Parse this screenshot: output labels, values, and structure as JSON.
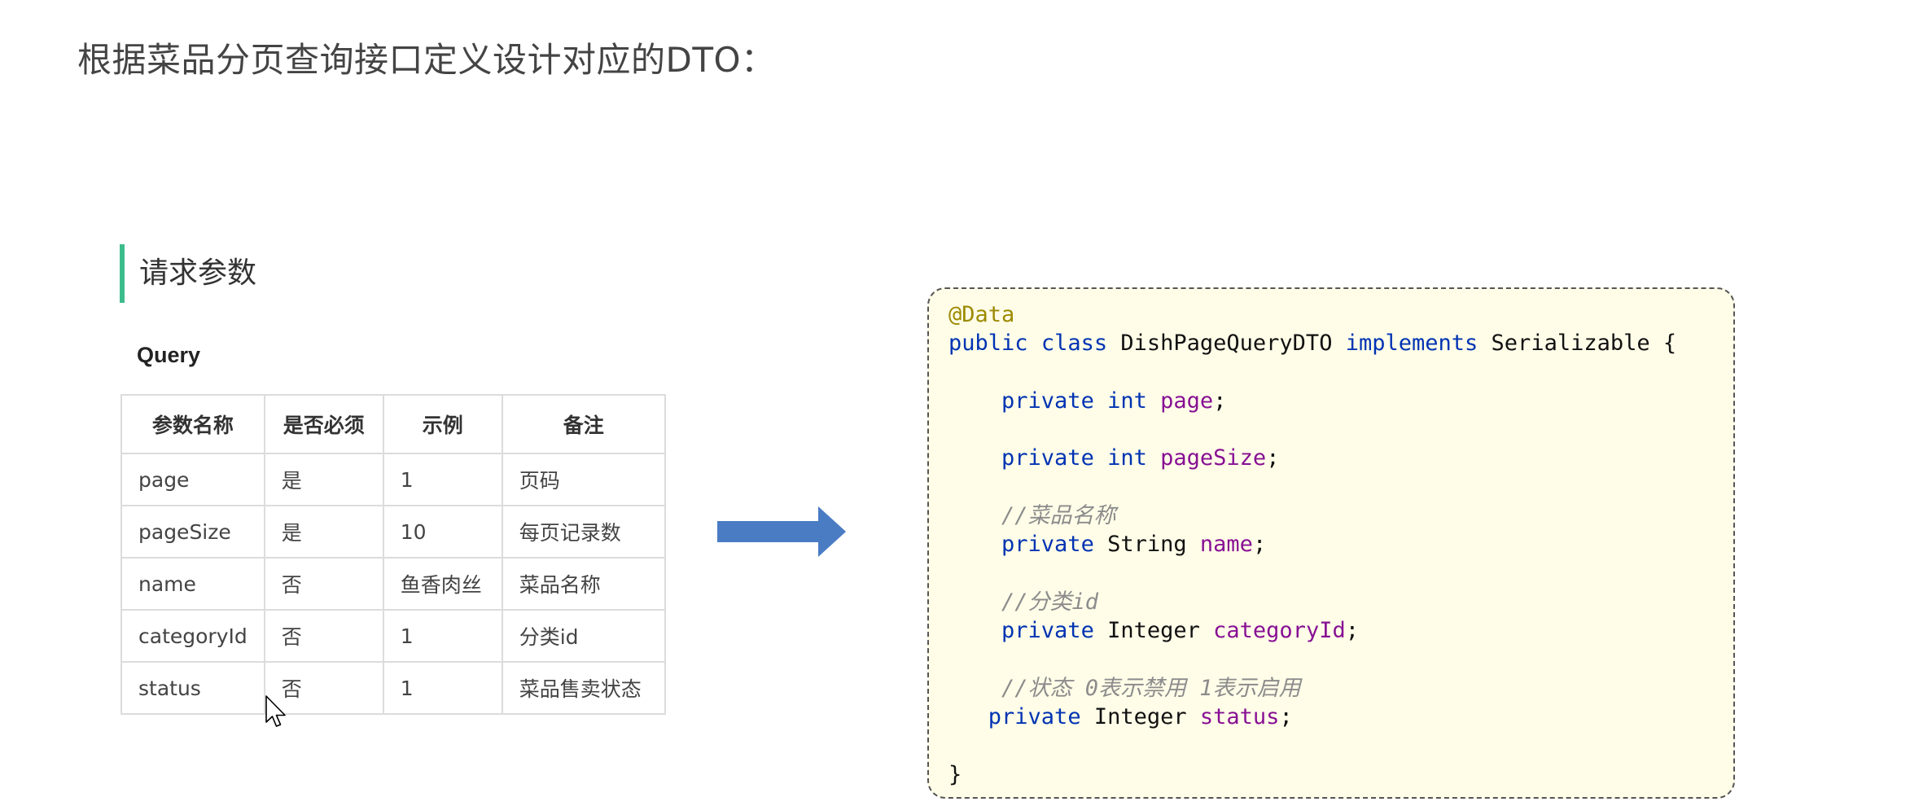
{
  "page_title": "根据菜品分页查询接口定义设计对应的DTO：",
  "section": {
    "title": "请求参数",
    "accent_color": "#3dbd8c"
  },
  "query": {
    "label": "Query",
    "headers": [
      "参数名称",
      "是否必须",
      "示例",
      "备注"
    ],
    "rows": [
      [
        "page",
        "是",
        "1",
        "页码"
      ],
      [
        "pageSize",
        "是",
        "10",
        "每页记录数"
      ],
      [
        "name",
        "否",
        "鱼香肉丝",
        "菜品名称"
      ],
      [
        "categoryId",
        "否",
        "1",
        "分类id"
      ],
      [
        "status",
        "否",
        "1",
        "菜品售卖状态"
      ]
    ]
  },
  "arrow": {
    "icon": "right-arrow-icon",
    "color": "#4a7cc4"
  },
  "code": {
    "background": "#fffde8",
    "line1_annotation": "@Data",
    "line2": {
      "kw1": "public",
      "kw2": "class",
      "class_name": "DishPageQueryDTO",
      "kw3": "implements",
      "iface": "Serializable",
      "brace": "{"
    },
    "field_page": {
      "mod": "private",
      "type": "int",
      "name": "page"
    },
    "field_pagesize": {
      "mod": "private",
      "type": "int",
      "name": "pageSize"
    },
    "comment_name": "//菜品名称",
    "field_name": {
      "mod": "private",
      "type": "String",
      "name": "name"
    },
    "comment_category": "//分类id",
    "field_category": {
      "mod": "private",
      "type": "Integer",
      "name": "categoryId"
    },
    "comment_status": "//状态 0表示禁用 1表示启用",
    "field_status": {
      "mod": "private",
      "type": "Integer",
      "name": "status"
    },
    "closing_brace": "}",
    "semicolon": ";"
  },
  "cursor": {
    "icon": "mouse-pointer-icon"
  }
}
